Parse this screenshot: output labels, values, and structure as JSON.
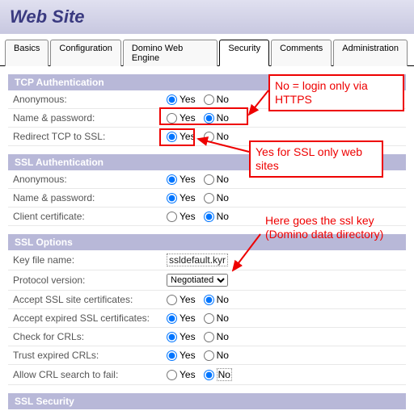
{
  "header": {
    "title": "Web Site"
  },
  "tabs": {
    "items": [
      "Basics",
      "Configuration",
      "Domino Web Engine",
      "Security",
      "Comments",
      "Administration"
    ],
    "active": 3
  },
  "sections": {
    "tcp_auth": {
      "title": "TCP Authentication",
      "rows": {
        "anonymous": {
          "label": "Anonymous:",
          "yes": "Yes",
          "no": "No",
          "selected": "yes"
        },
        "namepass": {
          "label": "Name & password:",
          "yes": "Yes",
          "no": "No",
          "selected": "no"
        },
        "redirect": {
          "label": "Redirect TCP to SSL:",
          "yes": "Yes",
          "no": "No",
          "selected": "yes"
        }
      }
    },
    "ssl_auth": {
      "title": "SSL Authentication",
      "rows": {
        "anonymous": {
          "label": "Anonymous:",
          "yes": "Yes",
          "no": "No",
          "selected": "yes"
        },
        "namepass": {
          "label": "Name & password:",
          "yes": "Yes",
          "no": "No",
          "selected": "yes"
        },
        "clientcert": {
          "label": "Client certificate:",
          "yes": "Yes",
          "no": "No",
          "selected": "no"
        }
      }
    },
    "ssl_opts": {
      "title": "SSL Options",
      "keyfile": {
        "label": "Key file name:",
        "value": "ssldefault.kyr"
      },
      "protocol": {
        "label": "Protocol version:",
        "value": "Negotiated"
      },
      "rows": {
        "sitecerts": {
          "label": "Accept SSL site certificates:",
          "yes": "Yes",
          "no": "No",
          "selected": "no"
        },
        "expcerts": {
          "label": "Accept expired SSL certificates:",
          "yes": "Yes",
          "no": "No",
          "selected": "yes"
        },
        "crls": {
          "label": "Check for CRLs:",
          "yes": "Yes",
          "no": "No",
          "selected": "yes"
        },
        "trustexp": {
          "label": "Trust expired CRLs:",
          "yes": "Yes",
          "no": "No",
          "selected": "yes"
        },
        "allowfail": {
          "label": "Allow CRL search to fail:",
          "yes": "Yes",
          "no": "No",
          "selected": "no"
        }
      }
    },
    "ssl_sec": {
      "title": "SSL Security"
    }
  },
  "annotations": {
    "box1": "No = login only via HTTPS",
    "box2": "Yes for SSL only web sites",
    "box3": "Here goes the ssl key (Domino data directory)"
  }
}
